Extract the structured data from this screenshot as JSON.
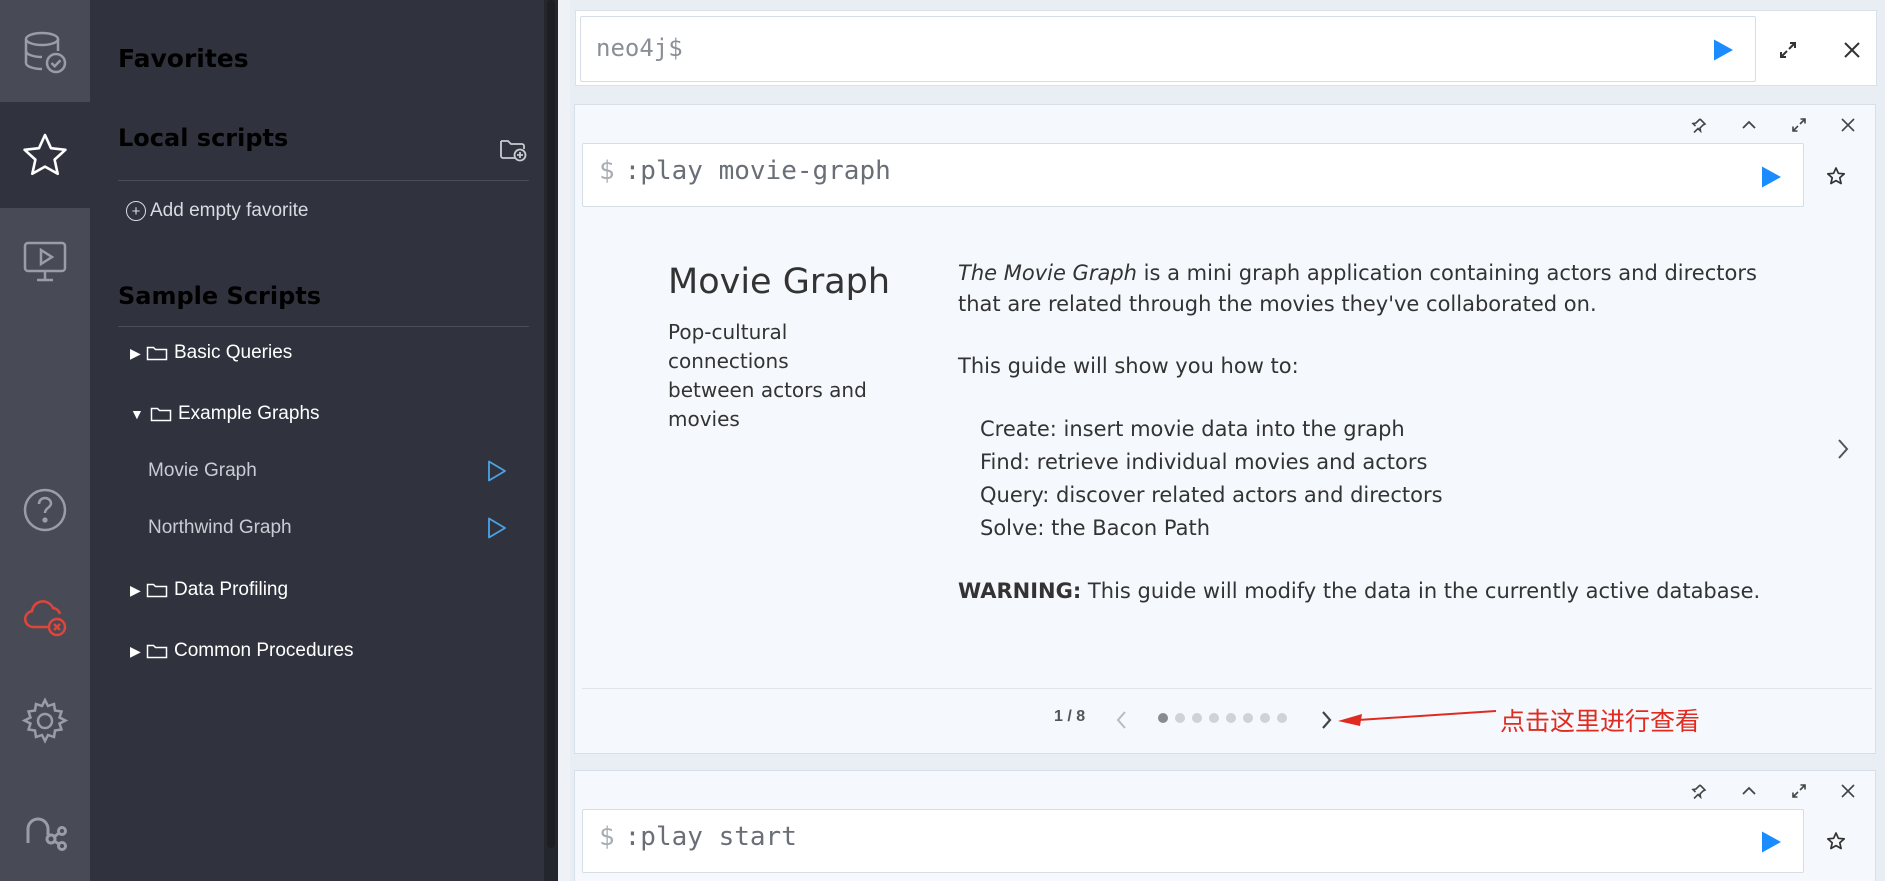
{
  "rail": {
    "items": [
      {
        "icon": "database-icon"
      },
      {
        "icon": "star-icon",
        "active": true
      },
      {
        "icon": "guides-monitor-icon"
      },
      {
        "icon": "help-icon"
      },
      {
        "icon": "cloud-disconnected-icon",
        "color": "#e0453a"
      },
      {
        "icon": "gear-icon"
      },
      {
        "icon": "neo4j-logo-icon"
      }
    ]
  },
  "drawer": {
    "title": "Favorites",
    "local_scripts": {
      "heading": "Local scripts",
      "add_empty": "Add empty favorite"
    },
    "sample_scripts": {
      "heading": "Sample Scripts",
      "folders": [
        {
          "label": "Basic Queries",
          "expanded": false
        },
        {
          "label": "Example Graphs",
          "expanded": true,
          "scripts": [
            "Movie Graph",
            "Northwind Graph"
          ]
        },
        {
          "label": "Data Profiling",
          "expanded": false
        },
        {
          "label": "Common Procedures",
          "expanded": false
        }
      ]
    }
  },
  "editor": {
    "prompt": "neo4j$"
  },
  "frames": [
    {
      "command": ":play movie-graph",
      "guide": {
        "title": "Movie Graph",
        "subtitle": "Pop-cultural connections between actors and movies",
        "intro_em": "The Movie Graph",
        "intro_rest": " is a mini graph application containing actors and directors that are related through the movies they've collaborated on.",
        "lead": "This guide will show you how to:",
        "items": [
          "Create: insert movie data into the graph",
          "Find: retrieve individual movies and actors",
          "Query: discover related actors and directors",
          "Solve: the Bacon Path"
        ],
        "warning_label": "WARNING:",
        "warning_text": " This guide will modify the data in the currently active database."
      },
      "pager": {
        "current": 1,
        "total": 8,
        "label": "1 / 8"
      }
    },
    {
      "command": ":play start"
    }
  ],
  "annotation": {
    "text": "点击这里进行查看",
    "color": "#e02b20"
  },
  "colors": {
    "accent_blue": "#1a8cff",
    "drawer_bg": "#30333d",
    "rail_bg": "#484b56",
    "play_outline": "#4aa3e8"
  }
}
